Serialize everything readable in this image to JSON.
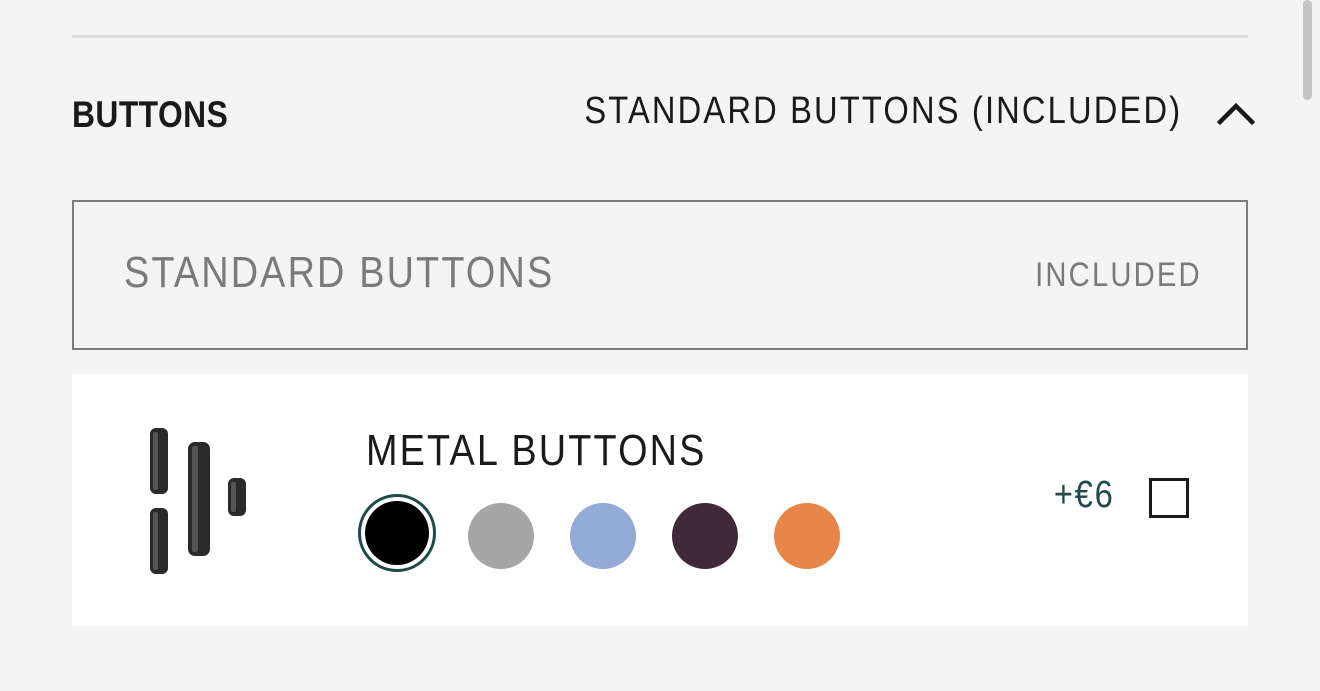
{
  "section": {
    "title": "BUTTONS",
    "selected_summary": "STANDARD BUTTONS (INCLUDED)",
    "expanded_icon": "chevron-up-icon"
  },
  "options": {
    "standard": {
      "name": "STANDARD BUTTONS",
      "price": "INCLUDED"
    },
    "metal": {
      "name": "METAL BUTTONS",
      "price": "+€6",
      "checked": false,
      "image_icon": "metal-buttons-icon",
      "selected_swatch": "#000000",
      "swatches": [
        "#000000",
        "#a6a6a6",
        "#94aad8",
        "#3f2a3b",
        "#e8864a"
      ]
    }
  },
  "colors": {
    "accent": "#1e4a47",
    "border": "#7a7a7a",
    "background": "#f4f4f4"
  }
}
